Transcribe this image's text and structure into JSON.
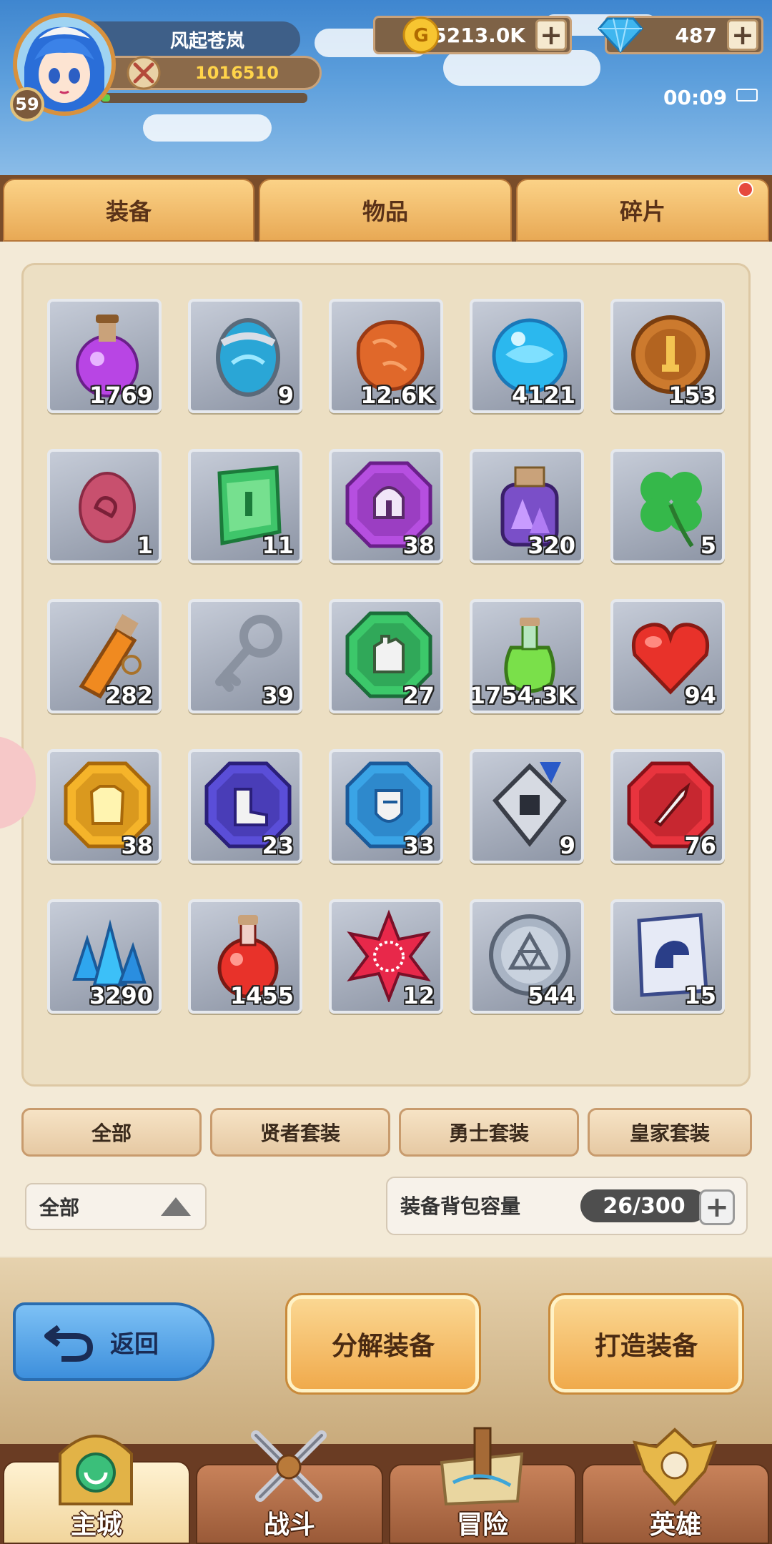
{
  "player": {
    "name": "风起苍岚",
    "power": "1016510",
    "level": "59"
  },
  "currency": {
    "gold": "5213.0K",
    "gems": "487",
    "plus": "+"
  },
  "status": {
    "time": "00:09"
  },
  "tabs": [
    "装备",
    "物品",
    "碎片"
  ],
  "items": [
    {
      "icon": "purple-potion-icon",
      "count": "1769"
    },
    {
      "icon": "blue-egg-icon",
      "count": "9"
    },
    {
      "icon": "copper-ore-icon",
      "count": "12.6K"
    },
    {
      "icon": "blue-orb-icon",
      "count": "4121"
    },
    {
      "icon": "bronze-medal-icon",
      "count": "153"
    },
    {
      "icon": "pink-egg-icon",
      "count": "1"
    },
    {
      "icon": "green-scroll-icon",
      "count": "11"
    },
    {
      "icon": "purple-helmet-gem-icon",
      "count": "38"
    },
    {
      "icon": "purple-crystal-jar-icon",
      "count": "320"
    },
    {
      "icon": "four-leaf-clover-icon",
      "count": "5"
    },
    {
      "icon": "orange-potion-icon",
      "count": "282"
    },
    {
      "icon": "silver-key-icon",
      "count": "39"
    },
    {
      "icon": "green-glove-gem-icon",
      "count": "27"
    },
    {
      "icon": "green-potion-icon",
      "count": "1754.3K"
    },
    {
      "icon": "red-heart-icon",
      "count": "94"
    },
    {
      "icon": "yellow-armor-gem-icon",
      "count": "38"
    },
    {
      "icon": "blue-boots-gem-icon",
      "count": "23"
    },
    {
      "icon": "cyan-shield-gem-icon",
      "count": "33"
    },
    {
      "icon": "silver-crest-icon",
      "count": "9"
    },
    {
      "icon": "red-sword-gem-icon",
      "count": "76"
    },
    {
      "icon": "blue-crystals-icon",
      "count": "3290"
    },
    {
      "icon": "red-potion-icon",
      "count": "1455"
    },
    {
      "icon": "red-star-gem-icon",
      "count": "12"
    },
    {
      "icon": "silver-coin-icon",
      "count": "544"
    },
    {
      "icon": "blue-map-scroll-icon",
      "count": "15"
    }
  ],
  "filters": [
    "全部",
    "贤者套装",
    "勇士套装",
    "皇家套装"
  ],
  "dropdown": {
    "value": "全部"
  },
  "capacity": {
    "label": "装备背包容量",
    "value": "26/300",
    "plus": "+"
  },
  "actions": {
    "back": "返回",
    "decompose": "分解装备",
    "forge": "打造装备"
  },
  "nav": [
    "主城",
    "战斗",
    "冒险",
    "英雄"
  ],
  "colors": {
    "accent": "#f0aa4c",
    "panel": "#f3ead7",
    "nav": "#9a5a38"
  }
}
